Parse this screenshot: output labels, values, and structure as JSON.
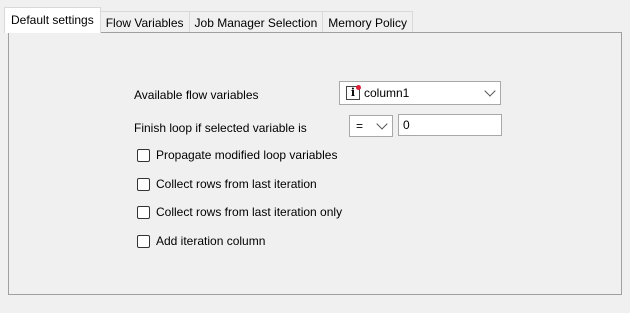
{
  "tabs": [
    {
      "label": "Default settings"
    },
    {
      "label": "Flow Variables"
    },
    {
      "label": "Job Manager Selection"
    },
    {
      "label": "Memory Policy"
    }
  ],
  "form": {
    "available_label": "Available flow variables",
    "available_value": "column1",
    "available_icon": "flow-variable-icon",
    "finish_label": "Finish loop if selected variable is",
    "operator_value": "=",
    "finish_value": "0"
  },
  "checkboxes": [
    {
      "label": "Propagate modified loop variables",
      "checked": false
    },
    {
      "label": "Collect rows from last iteration",
      "checked": false
    },
    {
      "label": "Collect rows from last iteration only",
      "checked": false
    },
    {
      "label": "Add iteration column",
      "checked": false
    }
  ]
}
